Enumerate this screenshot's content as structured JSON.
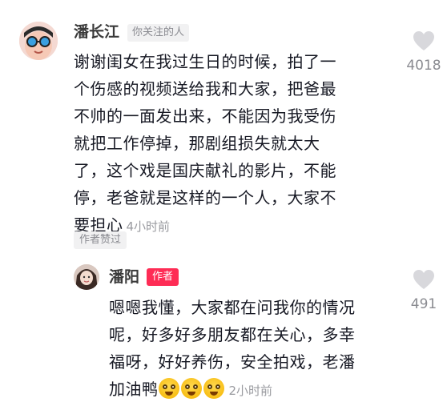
{
  "comment": {
    "author": "潘长江",
    "relation_tag": "你关注的人",
    "lines": [
      "谢谢闺女在我过生日的时候，拍了一",
      "个伤感的视频送给我和大家，把爸最",
      "不帅的一面发出来，不能因为我受伤",
      "就把工作停掉，那剧组损失就太大",
      "了，这个戏是国庆献礼的影片，不能",
      "停，老爸就是这样的一个人，大家不",
      "要担心"
    ],
    "time": "4小时前",
    "like_count": "4018",
    "liked_by_author": "作者赞过"
  },
  "reply": {
    "author": "潘阳",
    "author_tag": "作者",
    "lines": [
      "嗯嗯我懂，大家都在问我你的情况",
      "呢，好多好多朋友都在关心，多幸",
      "福呀，好好养伤，安全拍戏，老潘",
      "加油鸭"
    ],
    "emoji": [
      "laughing-face-emoji",
      "laughing-face-emoji",
      "laughing-face-emoji"
    ],
    "time": "2小时前",
    "like_count": "491"
  },
  "colors": {
    "accent": "#fe2c55",
    "muted_text": "#8a8b91",
    "heart": "#d8d8dc"
  }
}
